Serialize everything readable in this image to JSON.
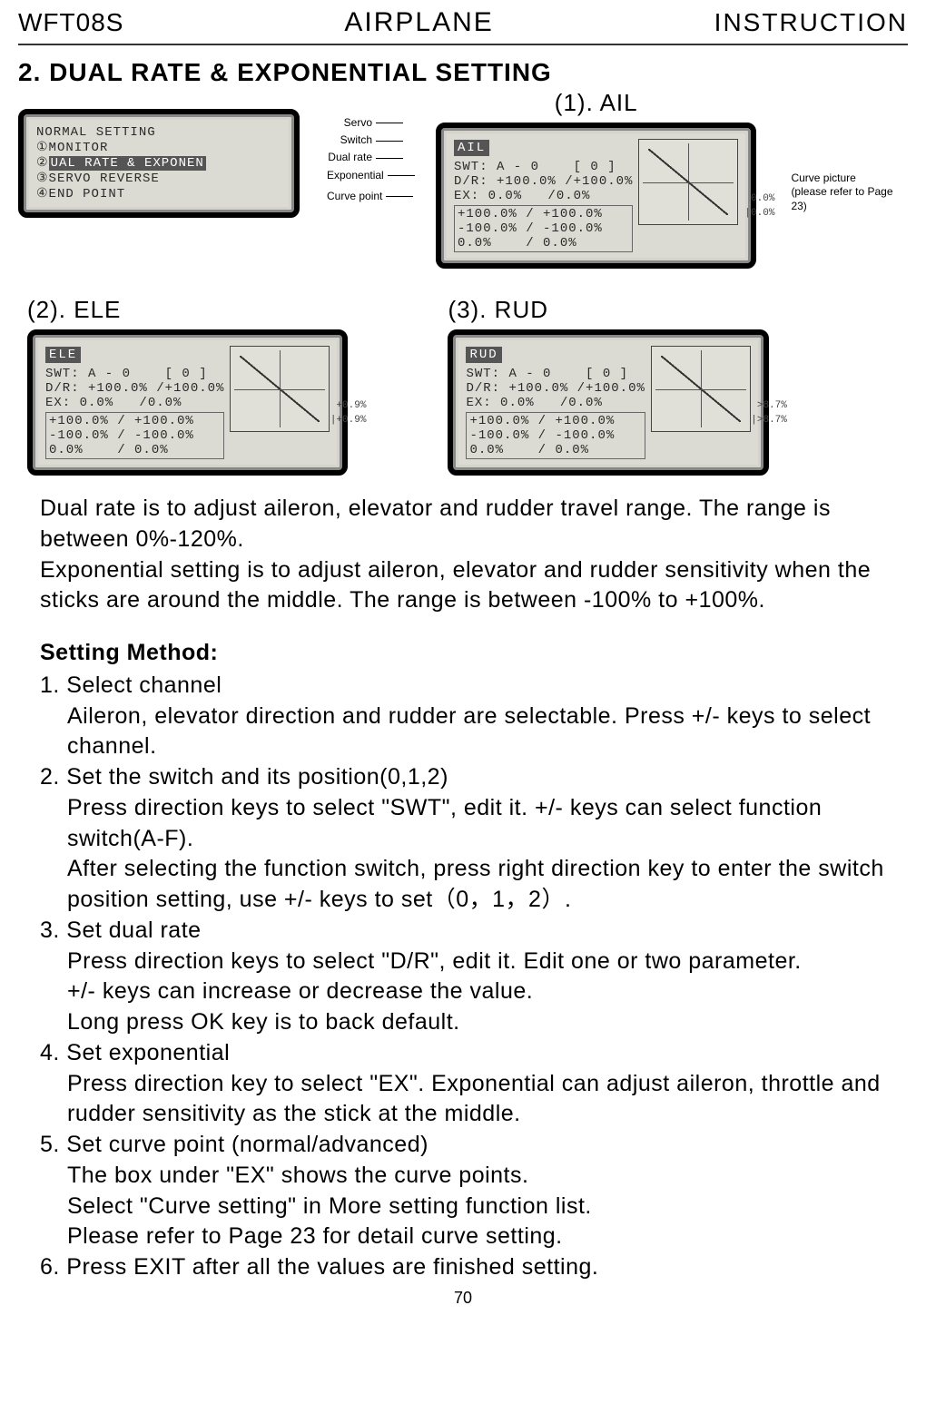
{
  "header": {
    "left": "WFT08S",
    "center": "AIRPLANE",
    "right": "INSTRUCTION"
  },
  "section_title": "2. DUAL RATE & EXPONENTIAL SETTING",
  "labels": {
    "ail": "(1). AIL",
    "ele": "(2). ELE",
    "rud": "(3). RUD"
  },
  "anno": {
    "servo": "Servo",
    "switch": "Switch",
    "dual_rate": "Dual rate",
    "exponential": "Exponential",
    "curve_point": "Curve point"
  },
  "curve_note": {
    "line1": "Curve picture",
    "line2": "(please refer to Page 23)"
  },
  "lcd_menu": {
    "title": "NORMAL SETTING",
    "item1": "①MONITOR",
    "item2_pre": "②",
    "item2_sel": "UAL RATE & EXPONEN",
    "item3": "③SERVO REVERSE",
    "item4": "④END POINT"
  },
  "lcd_ail": {
    "servo": "AIL",
    "swt": "SWT: A - 0    [ 0 ]",
    "dr": "D/R: +100.0% /+100.0%",
    "ex": "EX: 0.0%   /0.0%",
    "cp1": "+100.0% / +100.0%",
    "cp2": "-100.0% / -100.0%",
    "cp3": "0.0%    / 0.0%",
    "g1": "0.0%",
    "g2": "|0.0%"
  },
  "lcd_ele": {
    "servo": "ELE",
    "swt": "SWT: A - 0    [ 0 ]",
    "dr": "D/R: +100.0% /+100.0%",
    "ex": "EX: 0.0%   /0.0%",
    "cp1": "+100.0% / +100.0%",
    "cp2": "-100.0% / -100.0%",
    "cp3": "0.0%    / 0.0%",
    "g1": "+0.9%",
    "g2": "|+0.9%"
  },
  "lcd_rud": {
    "servo": "RUD",
    "swt": "SWT: A - 0    [ 0 ]",
    "dr": "D/R: +100.0% /+100.0%",
    "ex": "EX: 0.0%   /0.0%",
    "cp1": "+100.0% / +100.0%",
    "cp2": "-100.0% / -100.0%",
    "cp3": "0.0%    / 0.0%",
    "g1": ">8.7%",
    "g2": "|>8.7%"
  },
  "intro": {
    "p1": "Dual rate is to adjust aileron, elevator and rudder travel range. The range is between 0%-120%.",
    "p2": "Exponential setting is to adjust aileron, elevator and rudder sensitivity when the sticks are around the middle. The range is between -100% to +100%."
  },
  "setting": {
    "head": "Setting Method:",
    "s1": "1. Select channel",
    "s1a": "Aileron, elevator direction  and rudder are selectable. Press +/- keys to select channel.",
    "s2": "2. Set the switch and its position(0,1,2)",
    "s2a": "Press direction keys to select \"SWT\", edit it. +/- keys can select function switch(A-F).",
    "s2b": "After selecting the function switch, press right direction key to enter the switch position setting, use +/- keys to set（0，1，2）.",
    "s3": "3. Set dual rate",
    "s3a": "Press direction keys to select \"D/R\", edit it. Edit one or two parameter.",
    "s3b": "+/- keys can increase or decrease the value.",
    "s3c": "Long press OK key is to back default.",
    "s4": "4. Set exponential",
    "s4a": "Press direction key to select \"EX\". Exponential can adjust aileron, throttle and rudder sensitivity as the stick at the middle.",
    "s5": "5. Set curve point (normal/advanced)",
    "s5a": "The box under \"EX\" shows the curve points.",
    "s5b": "Select \"Curve setting\" in More setting function list.",
    "s5c": "Please refer to Page 23 for detail curve setting.",
    "s6": "6. Press EXIT after all the values are finished setting."
  },
  "page_num": "70"
}
